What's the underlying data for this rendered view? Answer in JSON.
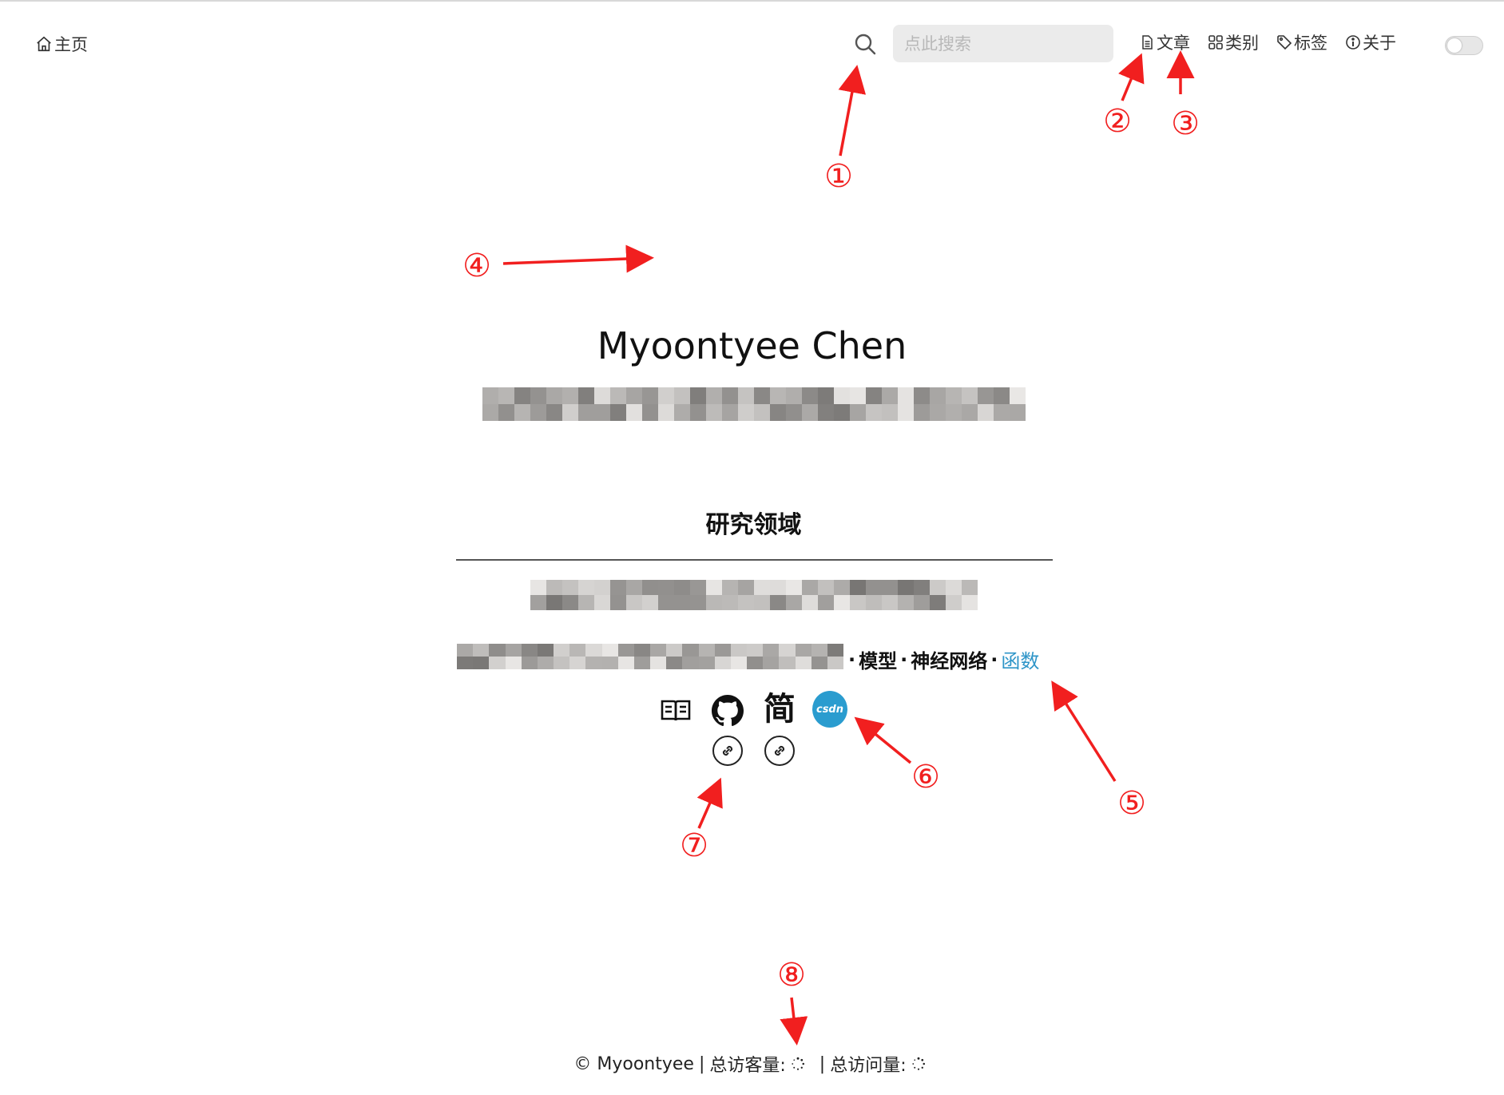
{
  "nav": {
    "home": "主页",
    "search_placeholder": "点此搜索",
    "links": [
      "文章",
      "类别",
      "标签",
      "关于"
    ]
  },
  "annotations": [
    "①",
    "②",
    "③",
    "④",
    "⑤",
    "⑥",
    "⑦",
    "⑧"
  ],
  "profile": {
    "name": "Myoontyee Chen"
  },
  "research": {
    "title": "研究领域",
    "keywords": [
      "模型",
      "神经网络"
    ],
    "link": "函数",
    "separator": "·"
  },
  "social": {
    "jian": "简",
    "csdn": "csdn"
  },
  "footer": {
    "copyright": "© Myoontyee",
    "visitors_label": "总访客量:",
    "views_label": "总访问量:",
    "divider": "|"
  },
  "colors": {
    "annotation": "#f11f1f",
    "link": "#2e95c8",
    "csdn": "#2a9ccf"
  }
}
